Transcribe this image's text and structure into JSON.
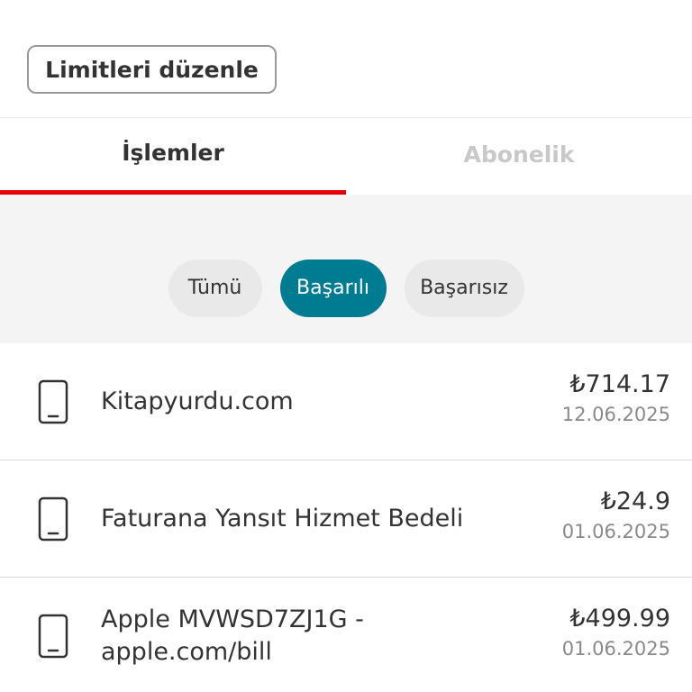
{
  "header": {
    "edit_limits_label": "Limitleri düzenle"
  },
  "tabs": [
    {
      "label": "İşlemler",
      "active": true
    },
    {
      "label": "Abonelik",
      "active": false
    }
  ],
  "filters": {
    "chips": [
      {
        "label": "Tümü",
        "selected": false
      },
      {
        "label": "Başarılı",
        "selected": true
      },
      {
        "label": "Başarısız",
        "selected": false
      }
    ]
  },
  "transactions": [
    {
      "icon": "phone-icon",
      "name": "Kitapyurdu.com",
      "amount": "₺714.17",
      "date": "12.06.2025"
    },
    {
      "icon": "phone-icon",
      "name": "Faturana Yansıt Hizmet Bedeli",
      "amount": "₺24.9",
      "date": "01.06.2025"
    },
    {
      "icon": "phone-icon",
      "name": "Apple MVWSD7ZJ1G - apple.com/bill",
      "amount": "₺499.99",
      "date": "01.06.2025"
    }
  ],
  "colors": {
    "accent_red": "#e60000",
    "chip_selected": "#007c92",
    "chip_default": "#e9e9e9",
    "filter_background": "#f4f4f4"
  }
}
